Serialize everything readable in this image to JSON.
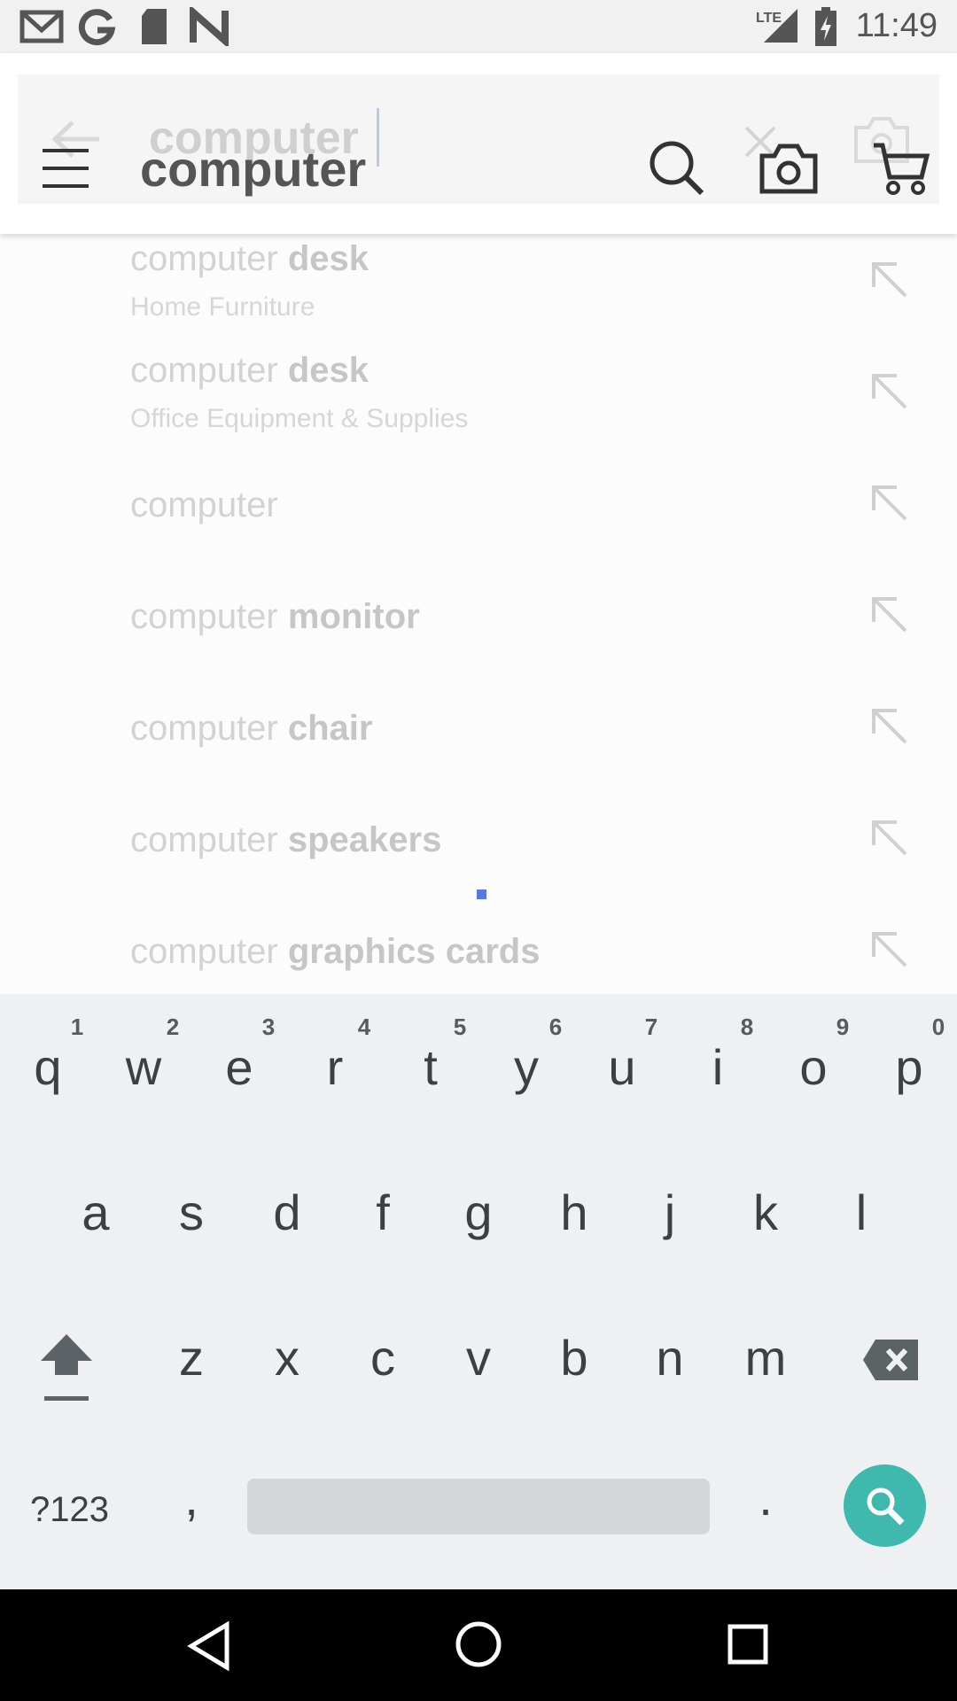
{
  "status_bar": {
    "time": "11:49",
    "network": "LTE",
    "icons": [
      "gmail-icon",
      "google-icon",
      "sd-card-icon",
      "n-icon",
      "signal-icon",
      "battery-charging-icon"
    ]
  },
  "toolbar": {
    "query_text": "computer",
    "ghost_query_text": "computer",
    "icons": [
      "menu-icon",
      "back-arrow-icon",
      "search-icon",
      "clear-icon",
      "camera-icon",
      "cart-icon"
    ]
  },
  "suggestions": [
    {
      "prefix": "computer",
      "suffix": "desk",
      "category": "Home Furniture"
    },
    {
      "prefix": "computer",
      "suffix": "desk",
      "category": "Office Equipment & Supplies"
    },
    {
      "prefix": "computer",
      "suffix": "",
      "category": ""
    },
    {
      "prefix": "computer",
      "suffix": "monitor",
      "category": ""
    },
    {
      "prefix": "computer",
      "suffix": "chair",
      "category": ""
    },
    {
      "prefix": "computer",
      "suffix": "speakers",
      "category": ""
    },
    {
      "prefix": "computer",
      "suffix": "graphics cards",
      "category": ""
    }
  ],
  "keyboard": {
    "row1": [
      "q",
      "w",
      "e",
      "r",
      "t",
      "y",
      "u",
      "i",
      "o",
      "p"
    ],
    "row1_hints": [
      "1",
      "2",
      "3",
      "4",
      "5",
      "6",
      "7",
      "8",
      "9",
      "0"
    ],
    "row2": [
      "a",
      "s",
      "d",
      "f",
      "g",
      "h",
      "j",
      "k",
      "l"
    ],
    "row3": [
      "z",
      "x",
      "c",
      "v",
      "b",
      "n",
      "m"
    ],
    "symbols_label": "?123",
    "comma_label": ",",
    "period_label": "."
  },
  "colors": {
    "accent": "#3fb8ad",
    "keyboard_bg": "#eef0f2",
    "loader": "#5a78dc"
  }
}
